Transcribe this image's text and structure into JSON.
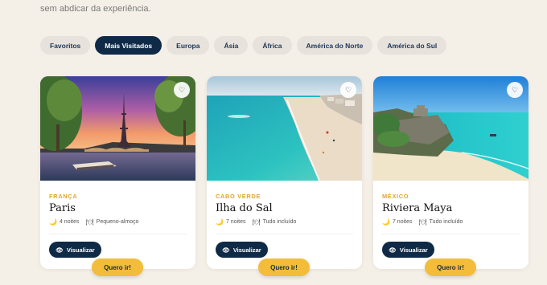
{
  "intro_text": "sem abdicar da experiência.",
  "tabs": [
    {
      "label": "Favoritos",
      "active": false
    },
    {
      "label": "Mais Visitados",
      "active": true
    },
    {
      "label": "Europa",
      "active": false
    },
    {
      "label": "Ásia",
      "active": false
    },
    {
      "label": "África",
      "active": false
    },
    {
      "label": "América do Norte",
      "active": false
    },
    {
      "label": "América do Sul",
      "active": false
    }
  ],
  "cards": [
    {
      "country": "FRANÇA",
      "city": "Paris",
      "nights": "4 noites",
      "plan": "Pequeno-almoço",
      "view_label": "Visualizar",
      "want_label": "Quero ir!",
      "image_icon": "eiffel-tower-photo"
    },
    {
      "country": "CABO VERDE",
      "city": "Ilha do Sal",
      "nights": "7 noites",
      "plan": "Tudo incluído",
      "view_label": "Visualizar",
      "want_label": "Quero ir!",
      "image_icon": "beach-photo"
    },
    {
      "country": "MÉXICO",
      "city": "Riviera Maya",
      "nights": "7 noites",
      "plan": "Tudo incluído",
      "view_label": "Visualizar",
      "want_label": "Quero ir!",
      "image_icon": "ruins-cliff-photo"
    }
  ],
  "icons": {
    "favorite": "heart-icon",
    "nights": "moon-icon",
    "plan": "plate-icon",
    "view": "eye-icon"
  },
  "colors": {
    "primary": "#0e2a47",
    "accent": "#f3bd3b",
    "country_label": "#e1a72c",
    "background": "#f4efe7"
  }
}
